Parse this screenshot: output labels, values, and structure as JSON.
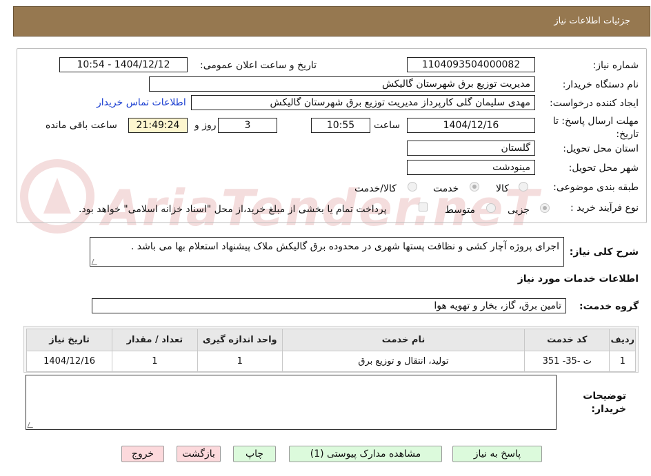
{
  "header": {
    "title": "جزئیات اطلاعات نیاز"
  },
  "watermark": {
    "text": "AriaTender.neT"
  },
  "form": {
    "need_number": {
      "label": "شماره نیاز:",
      "value": "1104093504000082"
    },
    "announce_datetime": {
      "label": "تاریخ و ساعت اعلان عمومی:",
      "value": "1404/12/12 - 10:54"
    },
    "buyer_org": {
      "label": "نام دستگاه خریدار:",
      "value": "مدیریت توزیع برق شهرستان گالیکش"
    },
    "requester": {
      "label": "ایجاد کننده درخواست:",
      "value": "مهدی سلیمان گلی کارپرداز مدیریت توزیع برق شهرستان گالیکش"
    },
    "contact_link": "اطلاعات تماس خریدار",
    "deadline": {
      "label": "مهلت ارسال پاسخ: تا تاریخ:",
      "date": "1404/12/16",
      "time_label": "ساعت",
      "time": "10:55",
      "days": "3",
      "days_label": "روز و",
      "remaining": "21:49:24",
      "remaining_label": "ساعت باقی مانده"
    },
    "province": {
      "label": "استان محل تحویل:",
      "value": "گلستان"
    },
    "city": {
      "label": "شهر محل تحویل:",
      "value": "مینودشت"
    },
    "category": {
      "label": "طبقه بندی موضوعی:",
      "options": [
        "کالا",
        "خدمت",
        "کالا/خدمت"
      ],
      "selected": "خدمت"
    },
    "process": {
      "label": "نوع فرآیند خرید :",
      "options": [
        "جزیی",
        "متوسط"
      ],
      "selected": "جزیی",
      "payment_note": "پرداخت تمام یا بخشی از مبلغ خرید،از محل \"اسناد خزانه اسلامی\" خواهد بود."
    }
  },
  "description": {
    "label": "شرح کلی نیاز:",
    "value": "اجرای پروژه آچار کشی و نظافت پستها شهری در محدوده برق گالیکش ملاک پیشنهاد استعلام بها می باشد ."
  },
  "services": {
    "title": "اطلاعات خدمات مورد نیاز",
    "group_label": "گروه خدمت:",
    "group_value": "تامین برق، گاز، بخار و تهویه هوا",
    "columns": [
      "ردیف",
      "کد خدمت",
      "نام خدمت",
      "واحد اندازه گیری",
      "تعداد / مقدار",
      "تاریخ نیاز"
    ],
    "rows": [
      [
        "1",
        "ت -35- 351",
        "تولید، انتقال و توزیع برق",
        "1",
        "1",
        "1404/12/16"
      ]
    ]
  },
  "notes": {
    "label": "توضیحات خریدار:"
  },
  "buttons": {
    "reply": "پاسخ به نیاز",
    "attachments": "مشاهده مدارک پیوستی (1)",
    "print": "چاپ",
    "back": "بازگشت",
    "exit": "خروج"
  },
  "colors": {
    "header_bg": "#967850",
    "link": "#1b3fd1",
    "green_btn": "#dcfadc",
    "pink_btn": "#fcd9dc"
  }
}
